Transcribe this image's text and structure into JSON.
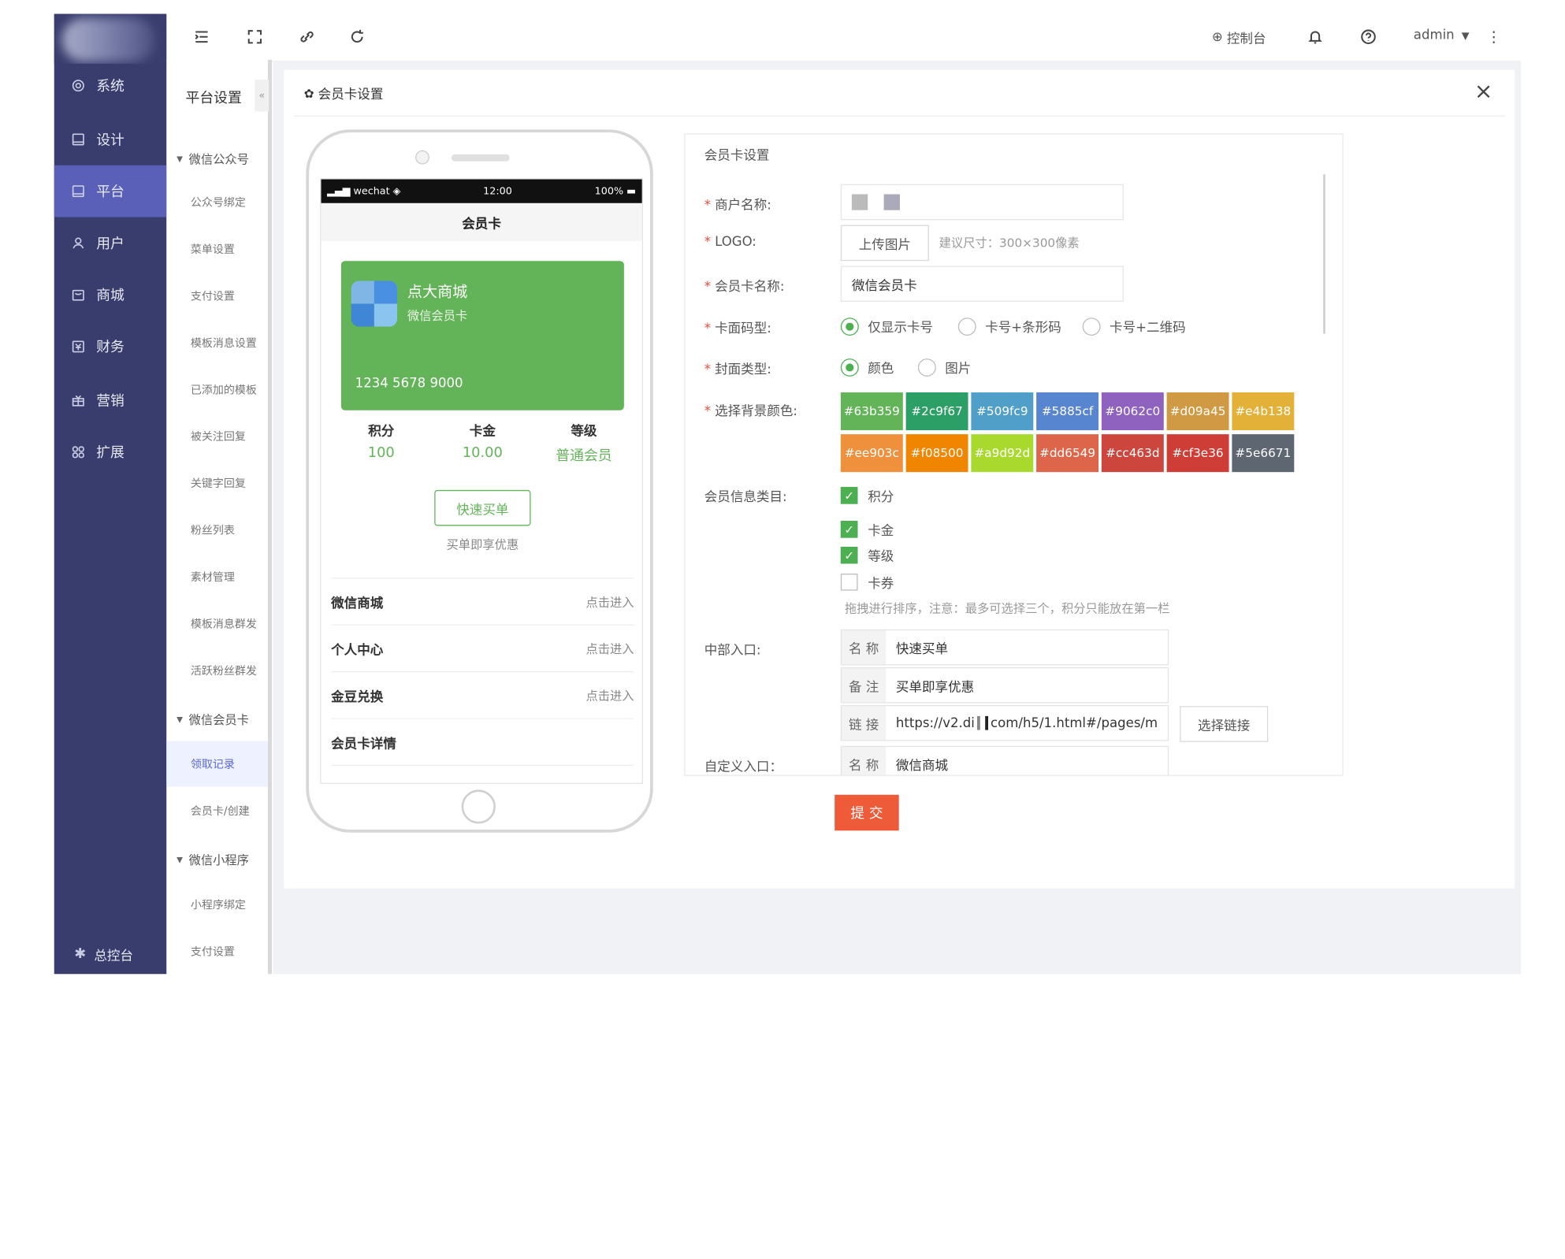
{
  "rail": {
    "items": [
      {
        "label": "系统",
        "icon": "settings-icon"
      },
      {
        "label": "设计",
        "icon": "design-icon"
      },
      {
        "label": "平台",
        "icon": "platform-icon"
      },
      {
        "label": "用户",
        "icon": "user-icon"
      },
      {
        "label": "商城",
        "icon": "shop-icon"
      },
      {
        "label": "财务",
        "icon": "finance-icon"
      },
      {
        "label": "营销",
        "icon": "gift-icon"
      },
      {
        "label": "扩展",
        "icon": "grid-icon"
      }
    ],
    "active_index": 2,
    "footer": "总控台"
  },
  "submenu": {
    "title": "平台设置",
    "collapse_glyph": "«",
    "group1": "微信公众号",
    "items1": [
      "公众号绑定",
      "菜单设置",
      "支付设置",
      "模板消息设置",
      "已添加的模板",
      "被关注回复",
      "关键字回复",
      "粉丝列表",
      "素材管理",
      "模板消息群发",
      "活跃粉丝群发"
    ],
    "group2": "微信会员卡",
    "items2": [
      "领取记录",
      "会员卡/创建"
    ],
    "active_item": "领取记录",
    "group3": "微信小程序",
    "items3": [
      "小程序绑定",
      "支付设置"
    ]
  },
  "topbar": {
    "console": "控制台",
    "user": "admin"
  },
  "panel": {
    "title": "会员卡设置",
    "close": "×"
  },
  "phone": {
    "status_left": "wechat",
    "status_time": "12:00",
    "status_right": "100%",
    "nav_title": "会员卡",
    "card_name": "点大商城",
    "card_sub": "微信会员卡",
    "card_number": "1234 5678 9000",
    "card_color": "#63b359",
    "stats": [
      {
        "label": "积分",
        "value": "100"
      },
      {
        "label": "卡金",
        "value": "10.00"
      },
      {
        "label": "等级",
        "value": "普通会员"
      }
    ],
    "quick_buy": "快速买单",
    "quick_buy_note": "买单即享优惠",
    "entries": [
      {
        "label": "微信商城",
        "action": "点击进入"
      },
      {
        "label": "个人中心",
        "action": "点击进入"
      },
      {
        "label": "金豆兑换",
        "action": "点击进入"
      },
      {
        "label": "会员卡详情",
        "action": ""
      }
    ]
  },
  "form": {
    "title": "会员卡设置",
    "merchant_label": "商户名称:",
    "logo_label": "LOGO:",
    "upload_button": "上传图片",
    "upload_hint": "建议尺寸：300×300像素",
    "card_name_label": "会员卡名称:",
    "card_name_value": "微信会员卡",
    "code_type_label": "卡面码型:",
    "code_options": [
      "仅显示卡号",
      "卡号+条形码",
      "卡号+二维码"
    ],
    "code_selected": 0,
    "cover_type_label": "封面类型:",
    "cover_options": [
      "颜色",
      "图片"
    ],
    "cover_selected": 0,
    "bg_color_label": "选择背景颜色:",
    "colors": [
      "#63b359",
      "#2c9f67",
      "#509fc9",
      "#5885cf",
      "#9062c0",
      "#d09a45",
      "#e4b138",
      "#ee903c",
      "#f08500",
      "#a9d92d",
      "#dd6549",
      "#cc463d",
      "#cf3e36",
      "#5e6671"
    ],
    "info_label": "会员信息类目:",
    "info_items": [
      {
        "label": "积分",
        "checked": true
      },
      {
        "label": "卡金",
        "checked": true
      },
      {
        "label": "等级",
        "checked": true
      },
      {
        "label": "卡券",
        "checked": false
      }
    ],
    "info_hint": "拖拽进行排序，注意：最多可选择三个，积分只能放在第一栏",
    "mid_entry_label": "中部入口:",
    "mid_name_label": "名 称",
    "mid_name_value": "快速买单",
    "mid_note_label": "备 注",
    "mid_note_value": "买单即享优惠",
    "mid_link_label": "链 接",
    "mid_link_prefix": "https://v2.di",
    "mid_link_suffix": "com/h5/1.html#/pages/m",
    "select_link_button": "选择链接",
    "custom_entry_label": "自定义入口：",
    "custom_name_label": "名 称",
    "custom_name_value": "微信商城"
  },
  "submit": "提 交"
}
